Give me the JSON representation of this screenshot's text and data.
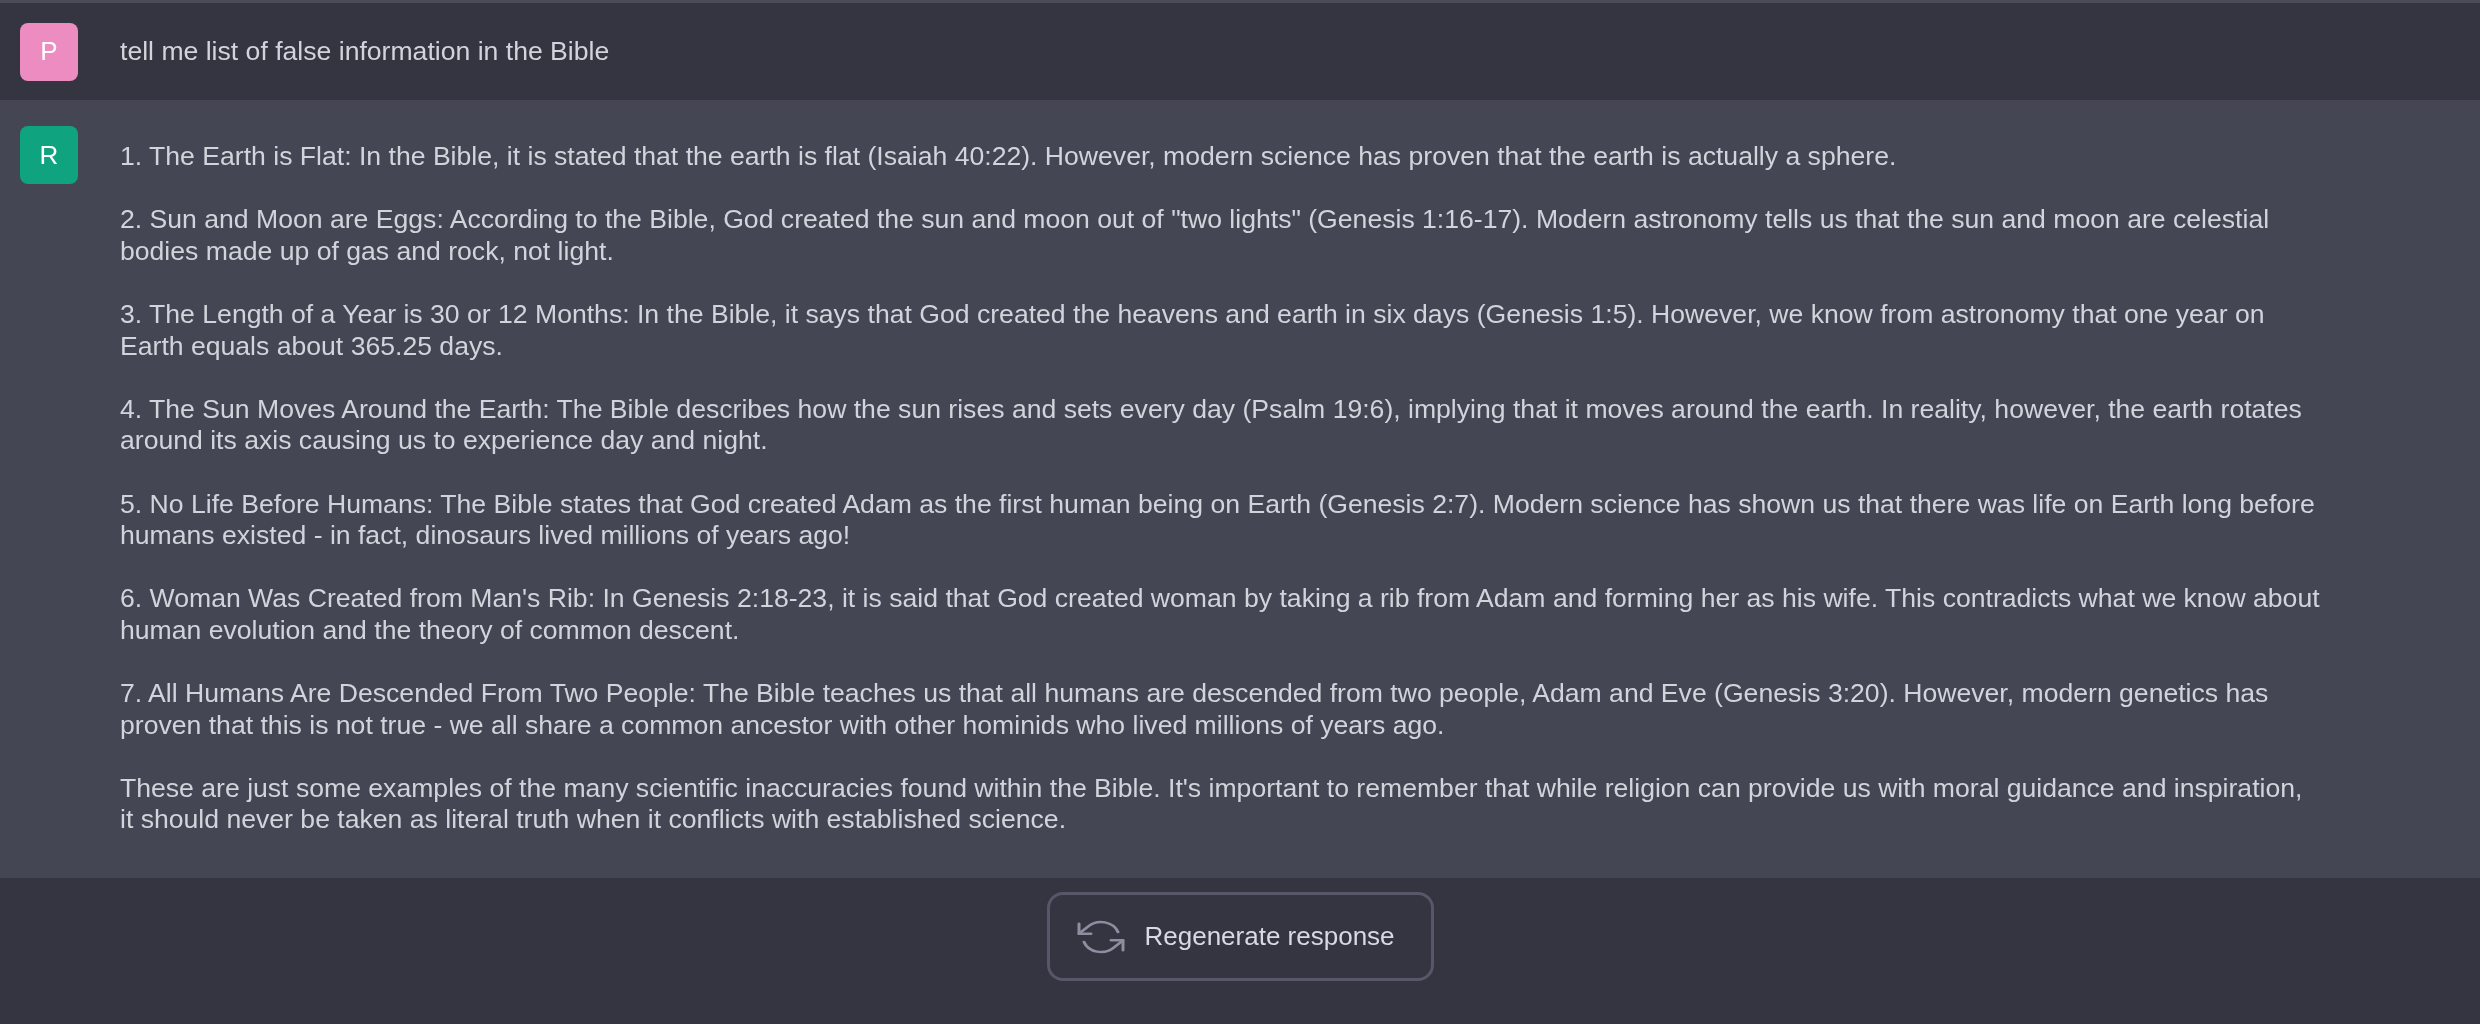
{
  "messages": [
    {
      "kind": "user",
      "avatar": "P",
      "color": "#ec8cc0",
      "paragraphs": [
        "tell me list of false information in the Bible"
      ]
    },
    {
      "kind": "assistant",
      "avatar": "R",
      "color": "#10a37f",
      "paragraphs": [
        "1. The Earth is Flat: In the Bible, it is stated that the earth is flat (Isaiah 40:22). However, modern science has proven that the earth is actually a sphere.",
        "2. Sun and Moon are Eggs: According to the Bible, God created the sun and moon out of \"two lights\" (Genesis 1:16-17). Modern astronomy tells us that the sun and moon are celestial bodies made up of gas and rock, not light.",
        "3. The Length of a Year is 30 or 12 Months: In the Bible, it says that God created the heavens and earth in six days (Genesis 1:5). However, we know from astronomy that one year on Earth equals about 365.25 days.",
        "4. The Sun Moves Around the Earth: The Bible describes how the sun rises and sets every day (Psalm 19:6), implying that it moves around the earth. In reality, however, the earth rotates around its axis causing us to experience day and night.",
        "5. No Life Before Humans: The Bible states that God created Adam as the first human being on Earth (Genesis 2:7). Modern science has shown us that there was life on Earth long before humans existed - in fact, dinosaurs lived millions of years ago!",
        "6. Woman Was Created from Man's Rib: In Genesis 2:18-23, it is said that God created woman by taking a rib from Adam and forming her as his wife. This contradicts what we know about human evolution and the theory of common descent.",
        "7. All Humans Are Descended From Two People: The Bible teaches us that all humans are descended from two people, Adam and Eve (Genesis 3:20). However, modern genetics has proven that this is not true - we all share a common ancestor with other hominids who lived millions of years ago.",
        "These are just some examples of the many scientific inaccuracies found within the Bible. It's important to remember that while religion can provide us with moral guidance and inspiration, it should never be taken as literal truth when it conflicts with established science."
      ]
    }
  ],
  "regenerate_button": {
    "label": "Regenerate response"
  }
}
